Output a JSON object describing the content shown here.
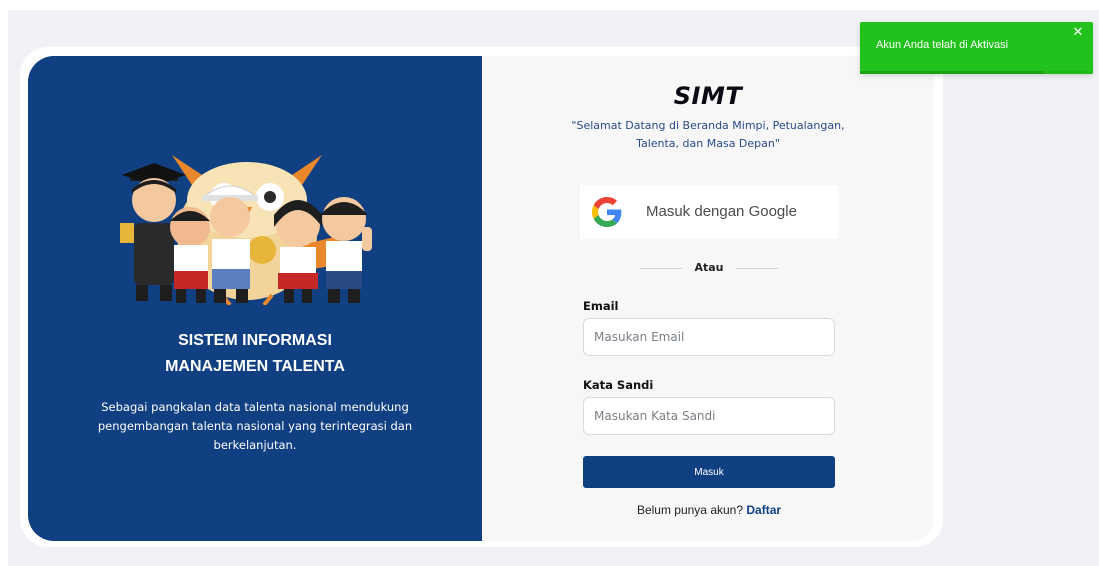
{
  "brand": {
    "name": "SIMT",
    "tagline": "\"Selamat Datang di Beranda Mimpi, Petualangan, Talenta, dan Masa Depan\""
  },
  "left_panel": {
    "title_line1": "SISTEM INFORMASI",
    "title_line2": "MANAJEMEN TALENTA",
    "description": "Sebagai pangkalan data talenta nasional mendukung pengembangan talenta nasional yang terintegrasi dan berkelanjutan.",
    "illustration": "students-and-owl-mascot-illustration"
  },
  "login": {
    "google_button": {
      "label": "Masuk dengan Google",
      "icon": "google-icon"
    },
    "divider_text": "Atau",
    "email": {
      "label": "Email",
      "placeholder": "Masukan Email",
      "value": ""
    },
    "password": {
      "label": "Kata Sandi",
      "placeholder": "Masukan Kata Sandi",
      "value": ""
    },
    "submit_label": "Masuk",
    "register_prompt": "Belum punya akun?",
    "register_link": "Daftar"
  },
  "toast": {
    "message": "Akun Anda telah di Aktivasi",
    "close_icon": "close-icon",
    "progress_remaining": 0.79
  },
  "colors": {
    "primary": "#103f82",
    "toast": "#22c21c",
    "background": "#f1f2f5"
  }
}
